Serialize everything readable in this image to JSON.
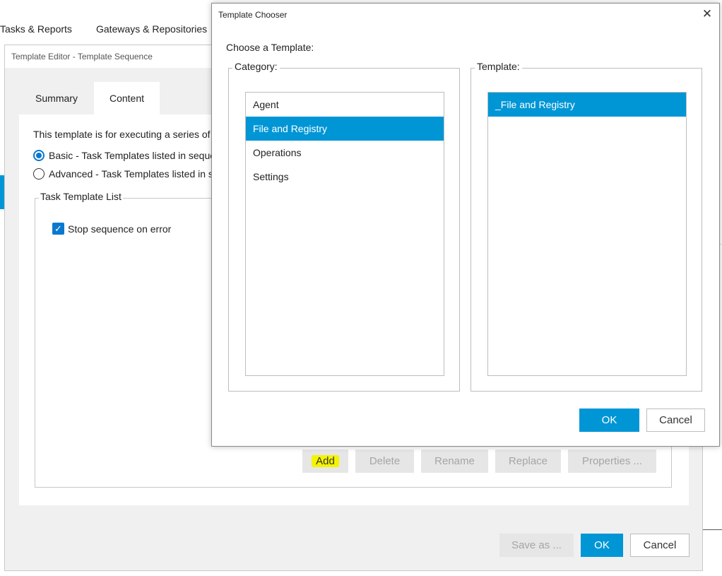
{
  "background_app": {
    "tabs": [
      "Tasks & Reports",
      "Gateways & Repositories"
    ]
  },
  "template_editor": {
    "title": "Template Editor - Template Sequence",
    "tabs": [
      {
        "label": "Summary",
        "active": false
      },
      {
        "label": "Content",
        "active": true
      }
    ],
    "description": "This template is for executing a series of tas",
    "radio_options": [
      {
        "label": "Basic - Task Templates listed in sequenc",
        "checked": true
      },
      {
        "label": "Advanced - Task Templates listed in seq",
        "checked": false
      }
    ],
    "task_list": {
      "legend": "Task Template List",
      "stop_on_error_label": "Stop sequence on error",
      "stop_on_error_checked": true
    },
    "list_buttons": {
      "add": "Add",
      "delete": "Delete",
      "rename": "Rename",
      "replace": "Replace",
      "properties": "Properties ..."
    },
    "footer_buttons": {
      "save_as": "Save as ...",
      "ok": "OK",
      "cancel": "Cancel"
    }
  },
  "template_chooser": {
    "title": "Template Chooser",
    "close_glyph": "✕",
    "choose_label": "Choose a Template:",
    "category": {
      "legend": "Category:",
      "items": [
        "Agent",
        "File and Registry",
        "Operations",
        "Settings"
      ],
      "selected_index": 1
    },
    "template": {
      "legend": "Template:",
      "items": [
        "_File and Registry"
      ],
      "selected_index": 0
    },
    "buttons": {
      "ok": "OK",
      "cancel": "Cancel"
    }
  },
  "colors": {
    "accent": "#0096d6",
    "highlight": "#f4f400"
  }
}
